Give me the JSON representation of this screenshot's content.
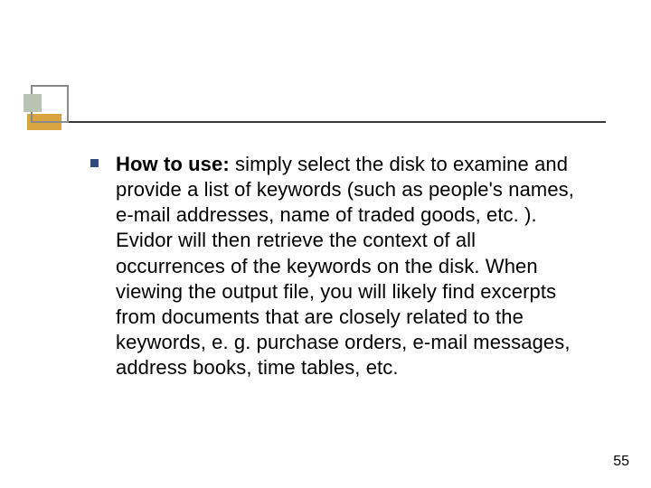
{
  "slide": {
    "bullet": {
      "lead": "How to use:",
      "body": " simply select the disk to examine and provide a list of keywords (such as people's names, e-mail addresses, name of traded goods, etc. ). Evidor will then retrieve the context of all occurrences of the keywords on the disk. When viewing the output file, you will likely find excerpts from documents that are closely related to the keywords, e. g. purchase orders, e-mail messages, address books, time tables, etc."
    },
    "page_number": "55"
  }
}
